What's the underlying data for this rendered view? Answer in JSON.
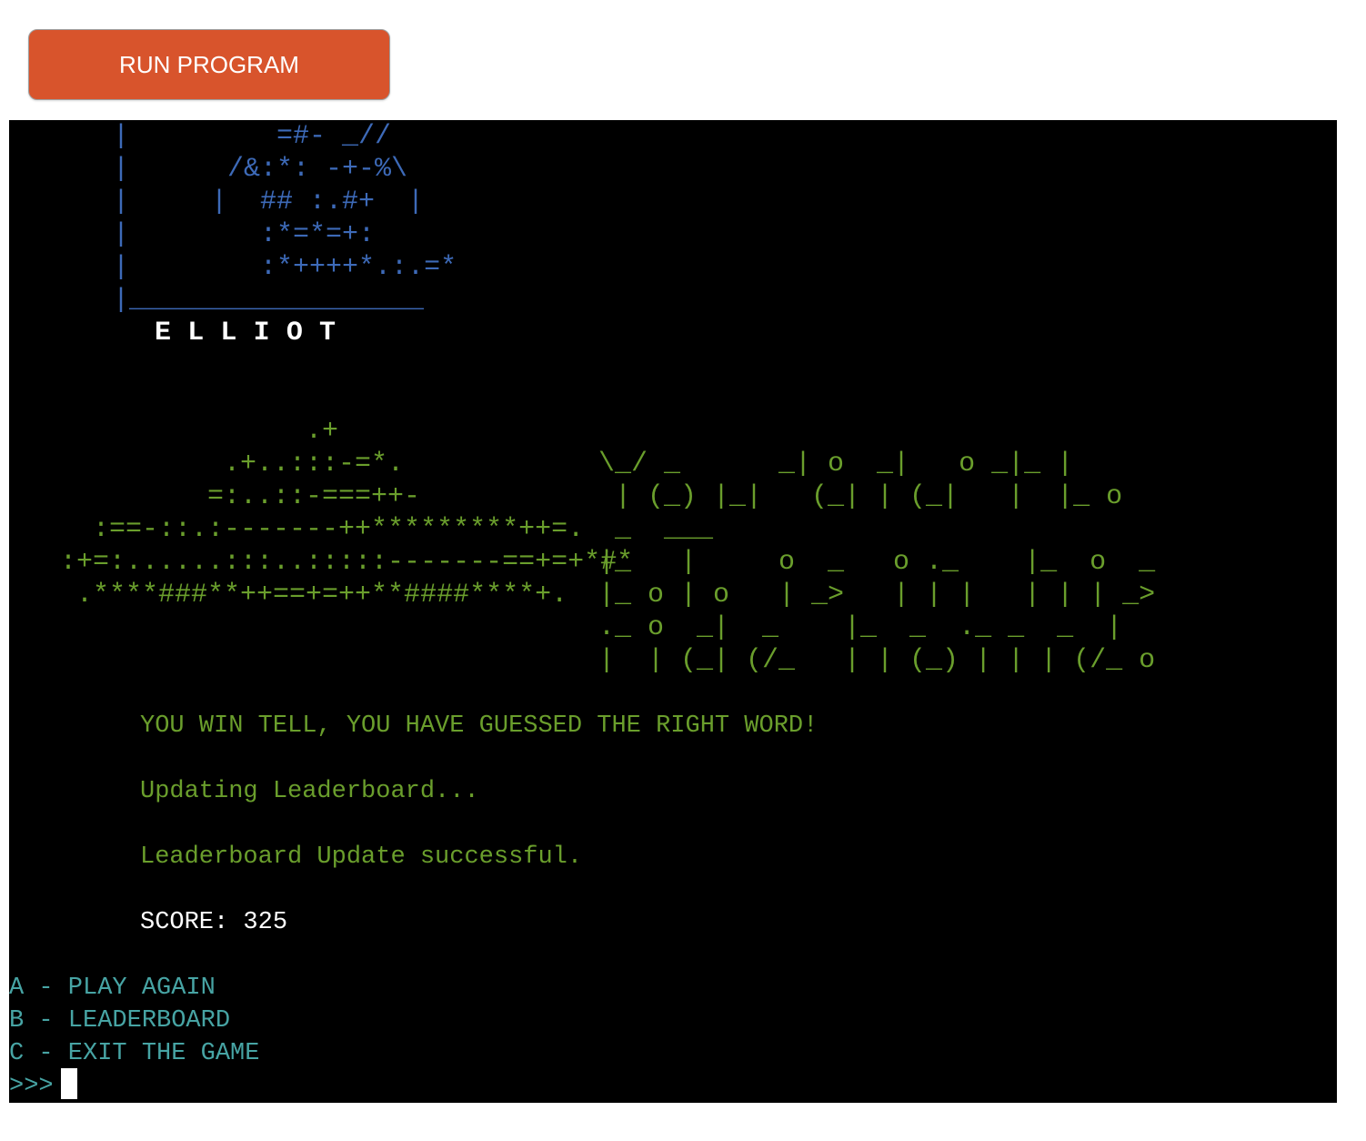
{
  "run_button": {
    "label": "RUN PROGRAM"
  },
  "terminal": {
    "elliot_art": "   |         =#- _//\n   |      /&:*: -+-%\\\n   |     |  ## :.#+  |\n   |        :*=*=+:\n   |        :*++++*.:.=*\n   |__________________",
    "elliot_name": "E L L I O T",
    "ufo_art": "               .+\n          .+..:::-=*.\n         =:..::-===++-\n  :==-::.:-------++*********++=.\n:+=:......:::..:::::-------==+=+*#*\n .****###**++==+=++**####****+.",
    "winner_art": "\\_/ _      _| o  _|   o _|_ |\n | (_) |_|   (_| | (_|   |  |_ o\n _  ___\n|_   |     o  _   o ._    |_  o  _\n|_ o | o   | _>   | | |   | | | _>\n._ o  _|  _    |_  _  ._ _  _  |\n|  | (_| (/_   | | (_) | | | (/_ o",
    "win_message": "YOU WIN TELL, YOU HAVE GUESSED THE RIGHT WORD!",
    "updating_message": "Updating Leaderboard...",
    "success_message": "Leaderboard Update successful.",
    "score_label": "SCORE:",
    "score_value": "325",
    "menu": [
      "A - PLAY AGAIN",
      "B - LEADERBOARD",
      "C - EXIT THE GAME"
    ],
    "prompt": ">>>",
    "colors": {
      "art_blue": "#3d6ab8",
      "text_green": "#6a9e2c",
      "menu_cyan": "#47a4a4",
      "button_orange": "#d8542c"
    }
  }
}
